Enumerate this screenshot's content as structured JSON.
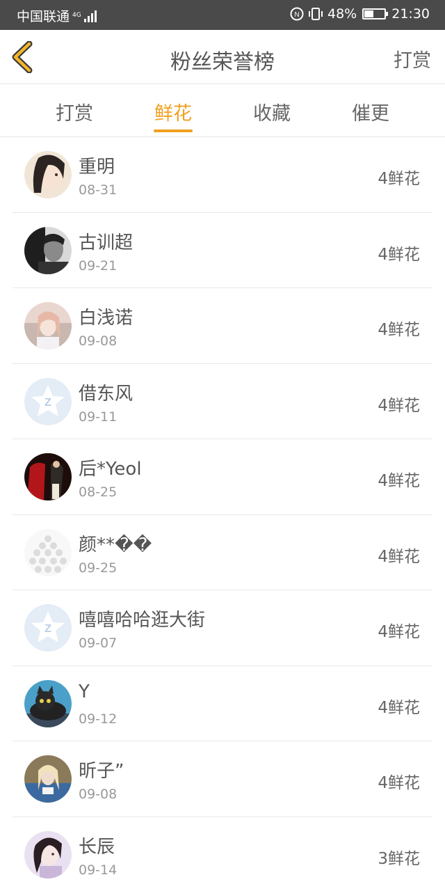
{
  "status_bar": {
    "carrier": "中国联通",
    "network": "4G",
    "battery_percent": "48%",
    "battery_level": 0.48,
    "time": "21:30",
    "icons": [
      "signal-icon",
      "nfc-icon",
      "vibrate-icon",
      "battery-icon"
    ]
  },
  "navbar": {
    "title": "粉丝荣誉榜",
    "action": "打赏",
    "back_icon": "chevron-left-icon",
    "accent": "#f0a020"
  },
  "tabs": [
    {
      "label": "打赏",
      "active": false
    },
    {
      "label": "鲜花",
      "active": true
    },
    {
      "label": "收藏",
      "active": false
    },
    {
      "label": "催更",
      "active": false
    }
  ],
  "fans": [
    {
      "name": "重明",
      "date": "08-31",
      "count": "4鲜花",
      "avatar": "photo-avatar"
    },
    {
      "name": "古训超",
      "date": "09-21",
      "count": "4鲜花",
      "avatar": "photo-avatar"
    },
    {
      "name": "白浅诺",
      "date": "09-08",
      "count": "4鲜花",
      "avatar": "photo-avatar"
    },
    {
      "name": "借东风",
      "date": "09-11",
      "count": "4鲜花",
      "avatar": "default-star-avatar"
    },
    {
      "name": "后*Yeol",
      "date": "08-25",
      "count": "4鲜花",
      "avatar": "photo-avatar"
    },
    {
      "name": "颜**��",
      "date": "09-25",
      "count": "4鲜花",
      "avatar": "photo-avatar"
    },
    {
      "name": "嘻嘻哈哈逛大街",
      "date": "09-07",
      "count": "4鲜花",
      "avatar": "default-star-avatar"
    },
    {
      "name": "Y",
      "date": "09-12",
      "count": "4鲜花",
      "avatar": "cat-avatar"
    },
    {
      "name": "昕子”",
      "date": "09-08",
      "count": "4鲜花",
      "avatar": "photo-avatar"
    },
    {
      "name": "长辰",
      "date": "09-14",
      "count": "3鲜花",
      "avatar": "photo-avatar"
    }
  ]
}
